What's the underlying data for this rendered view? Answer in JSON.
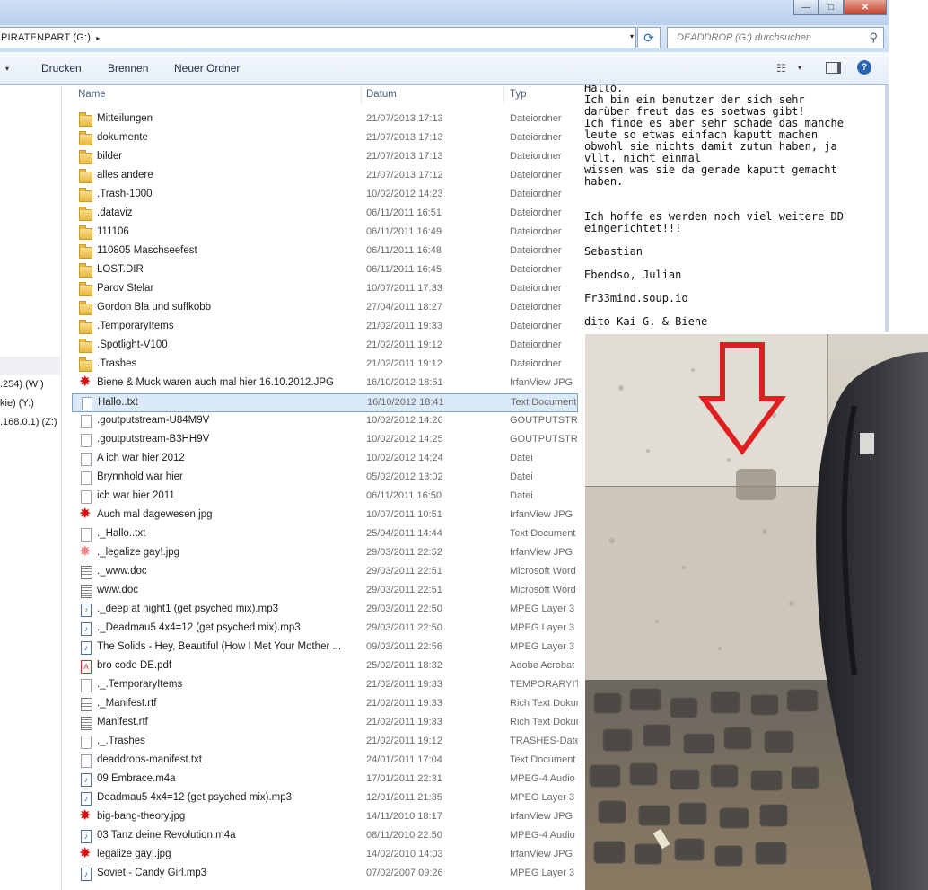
{
  "window": {
    "minimize": "—",
    "maximize": "□",
    "close": "✕"
  },
  "address": {
    "path": "PIRATENPART (G:)",
    "arrow": "▸",
    "dropdown": "▾",
    "refresh": "⟳",
    "search_placeholder": "DEADDROP (G:) durchsuchen"
  },
  "toolbar": {
    "print": "Drucken",
    "burn": "Brennen",
    "new_folder": "Neuer Ordner",
    "help": "?"
  },
  "nav": {
    "items": [
      ".254) (W:)",
      "kie) (Y:)",
      ".168.0.1) (Z:)"
    ]
  },
  "columns": {
    "name": "Name",
    "date": "Datum",
    "type": "Typ"
  },
  "files": [
    {
      "name": "Mitteilungen",
      "date": "21/07/2013 17:13",
      "type": "Dateiordner",
      "icon": "folder"
    },
    {
      "name": "dokumente",
      "date": "21/07/2013 17:13",
      "type": "Dateiordner",
      "icon": "folder"
    },
    {
      "name": "bilder",
      "date": "21/07/2013 17:13",
      "type": "Dateiordner",
      "icon": "folder"
    },
    {
      "name": "alles andere",
      "date": "21/07/2013 17:12",
      "type": "Dateiordner",
      "icon": "folder"
    },
    {
      "name": ".Trash-1000",
      "date": "10/02/2012 14:23",
      "type": "Dateiordner",
      "icon": "folder"
    },
    {
      "name": ".dataviz",
      "date": "06/11/2011 16:51",
      "type": "Dateiordner",
      "icon": "folder"
    },
    {
      "name": "111106",
      "date": "06/11/2011 16:49",
      "type": "Dateiordner",
      "icon": "folder"
    },
    {
      "name": "110805 Maschseefest",
      "date": "06/11/2011 16:48",
      "type": "Dateiordner",
      "icon": "folder"
    },
    {
      "name": "LOST.DIR",
      "date": "06/11/2011 16:45",
      "type": "Dateiordner",
      "icon": "folder"
    },
    {
      "name": "Parov Stelar",
      "date": "10/07/2011 17:33",
      "type": "Dateiordner",
      "icon": "folder"
    },
    {
      "name": "Gordon Bla und suffkobb",
      "date": "27/04/2011 18:27",
      "type": "Dateiordner",
      "icon": "folder"
    },
    {
      "name": ".TemporaryItems",
      "date": "21/02/2011 19:33",
      "type": "Dateiordner",
      "icon": "folder"
    },
    {
      "name": ".Spotlight-V100",
      "date": "21/02/2011 19:12",
      "type": "Dateiordner",
      "icon": "folder"
    },
    {
      "name": ".Trashes",
      "date": "21/02/2011 19:12",
      "type": "Dateiordner",
      "icon": "folder"
    },
    {
      "name": "Biene & Muck waren auch mal hier 16.10.2012.JPG",
      "date": "16/10/2012 18:51",
      "type": "IrfanView JPG",
      "icon": "image"
    },
    {
      "name": "Hallo..txt",
      "date": "16/10/2012 18:41",
      "type": "Text Document",
      "icon": "file",
      "selected": true
    },
    {
      "name": ".goutputstream-U84M9V",
      "date": "10/02/2012 14:26",
      "type": "GOUTPUTSTREAM",
      "icon": "file"
    },
    {
      "name": ".goutputstream-B3HH9V",
      "date": "10/02/2012 14:25",
      "type": "GOUTPUTSTREAM",
      "icon": "file"
    },
    {
      "name": "A ich war hier 2012",
      "date": "10/02/2012 14:24",
      "type": "Datei",
      "icon": "file"
    },
    {
      "name": "Brynnhold war hier",
      "date": "05/02/2012 13:02",
      "type": "Datei",
      "icon": "file"
    },
    {
      "name": "ich war hier 2011",
      "date": "06/11/2011 16:50",
      "type": "Datei",
      "icon": "file"
    },
    {
      "name": "Auch mal dagewesen.jpg",
      "date": "10/07/2011 10:51",
      "type": "IrfanView JPG",
      "icon": "image"
    },
    {
      "name": "._Hallo..txt",
      "date": "25/04/2011 14:44",
      "type": "Text Document",
      "icon": "file"
    },
    {
      "name": "._legalize gay!.jpg",
      "date": "29/03/2011 22:52",
      "type": "IrfanView JPG",
      "icon": "image-faded"
    },
    {
      "name": "._www.doc",
      "date": "29/03/2011 22:51",
      "type": "Microsoft Word",
      "icon": "lines"
    },
    {
      "name": "www.doc",
      "date": "29/03/2011 22:51",
      "type": "Microsoft Word",
      "icon": "lines"
    },
    {
      "name": "._deep at night1 (get psyched mix).mp3",
      "date": "29/03/2011 22:50",
      "type": "MPEG Layer 3",
      "icon": "audio"
    },
    {
      "name": "._Deadmau5 4x4=12 (get psyched mix).mp3",
      "date": "29/03/2011 22:50",
      "type": "MPEG Layer 3",
      "icon": "audio"
    },
    {
      "name": "The Solids - Hey, Beautiful (How I Met Your Mother ...",
      "date": "09/03/2011 22:56",
      "type": "MPEG Layer 3",
      "icon": "audio"
    },
    {
      "name": "bro code DE.pdf",
      "date": "25/02/2011 18:32",
      "type": "Adobe Acrobat",
      "icon": "pdf"
    },
    {
      "name": "._.TemporaryItems",
      "date": "21/02/2011 19:33",
      "type": "TEMPORARYITEMS",
      "icon": "file"
    },
    {
      "name": "._Manifest.rtf",
      "date": "21/02/2011 19:33",
      "type": "Rich Text Dokument",
      "icon": "lines"
    },
    {
      "name": "Manifest.rtf",
      "date": "21/02/2011 19:33",
      "type": "Rich Text Dokument",
      "icon": "lines"
    },
    {
      "name": "._.Trashes",
      "date": "21/02/2011 19:12",
      "type": "TRASHES-Datei",
      "icon": "file"
    },
    {
      "name": "deaddrops-manifest.txt",
      "date": "24/01/2011 17:04",
      "type": "Text Document",
      "icon": "file"
    },
    {
      "name": "09 Embrace.m4a",
      "date": "17/01/2011 22:31",
      "type": "MPEG-4 Audio",
      "icon": "audio"
    },
    {
      "name": "Deadmau5 4x4=12 (get psyched mix).mp3",
      "date": "12/01/2011 21:35",
      "type": "MPEG Layer 3",
      "icon": "audio"
    },
    {
      "name": "big-bang-theory.jpg",
      "date": "14/11/2010 18:17",
      "type": "IrfanView JPG",
      "icon": "image"
    },
    {
      "name": "03 Tanz deine Revolution.m4a",
      "date": "08/11/2010 22:50",
      "type": "MPEG-4 Audio",
      "icon": "audio"
    },
    {
      "name": "legalize gay!.jpg",
      "date": "14/02/2010 14:03",
      "type": "IrfanView JPG",
      "icon": "image"
    },
    {
      "name": "Soviet - Candy Girl.mp3",
      "date": "07/02/2007 09:26",
      "type": "MPEG Layer 3",
      "icon": "audio"
    }
  ],
  "preview": {
    "lines": [
      "Hallo.",
      "Ich bin ein benutzer der sich sehr",
      "darüber freut das es soetwas gibt!",
      "Ich finde es aber sehr schade das manche",
      "leute so etwas einfach kaputt machen",
      "obwohl sie nichts damit zutun haben, ja",
      "vllt. nicht einmal",
      "wissen was sie da gerade kaputt gemacht",
      "haben.",
      "",
      "",
      "Ich hoffe es werden noch viel weitere DD",
      "eingerichtet!!!",
      "",
      "Sebastian",
      "",
      "Ebendso, Julian",
      "",
      "Fr33mind.soup.io",
      "",
      "dito Kai G. & Biene"
    ]
  },
  "colors": {
    "arrow": "#e02020",
    "selection": "#dbeaf9",
    "folder": "#e8b940"
  }
}
